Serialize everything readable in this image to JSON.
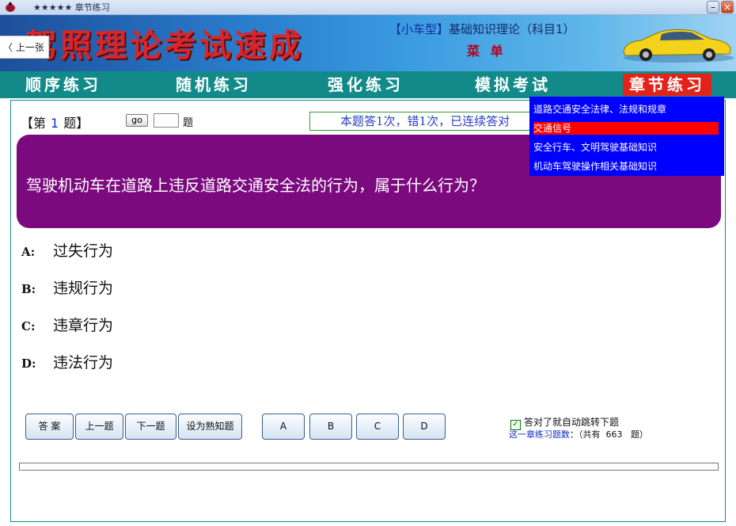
{
  "window": {
    "title": "★★★★★  章节练习",
    "min_glyph": "–",
    "close_glyph": "×"
  },
  "banner": {
    "title": "驾照理论考试速成",
    "subtitle_tag": "【小车型】",
    "subtitle_text": "基础知识理论（科目1）",
    "menu_label": "菜 单"
  },
  "prev_image": "〈 上一张",
  "nav": {
    "items": [
      {
        "label": "顺序练习"
      },
      {
        "label": "随机练习"
      },
      {
        "label": "强化练习"
      },
      {
        "label": "模拟考试"
      },
      {
        "label": "章节练习"
      }
    ],
    "active_index": 4
  },
  "dropdown": {
    "items": [
      "道路交通安全法律、法规和规章",
      "交通信号",
      "安全行车、文明驾驶基础知识",
      "机动车驾驶操作相关基础知识"
    ],
    "selected_index": 1
  },
  "question": {
    "prefix": "【第",
    "number": "1",
    "suffix": "题】",
    "go_label": "go",
    "go_value": "",
    "go_suffix": "题",
    "stats": "本题答1次，错1次，已连续答对",
    "text": "驾驶机动车在道路上违反道路交通安全法的行为，属于什么行为？"
  },
  "options": [
    {
      "letter": "A:",
      "text": "过失行为"
    },
    {
      "letter": "B:",
      "text": "违规行为"
    },
    {
      "letter": "C:",
      "text": "违章行为"
    },
    {
      "letter": "D:",
      "text": "违法行为"
    }
  ],
  "buttons": {
    "answer": "答 案",
    "prev": "上一题",
    "next": "下一题",
    "mark_known": "设为熟知题",
    "a": "A",
    "b": "B",
    "c": "C",
    "d": "D"
  },
  "auto_jump": {
    "checked": true,
    "label": "答对了就自动跳转下题"
  },
  "count": {
    "label": "这一章练习题数",
    "prefix": "：（共有",
    "total": "663",
    "suffix": "题）"
  },
  "colors": {
    "nav_bg": "#138a8a",
    "active_tab": "#e2231a",
    "question_bg": "#7a0a7e",
    "dropdown_bg": "#0000ff",
    "dropdown_selected": "#ff0000"
  },
  "icons": {
    "app": "ladybug-icon",
    "car": "car-icon",
    "checkbox": "checkbox-checked-icon"
  }
}
